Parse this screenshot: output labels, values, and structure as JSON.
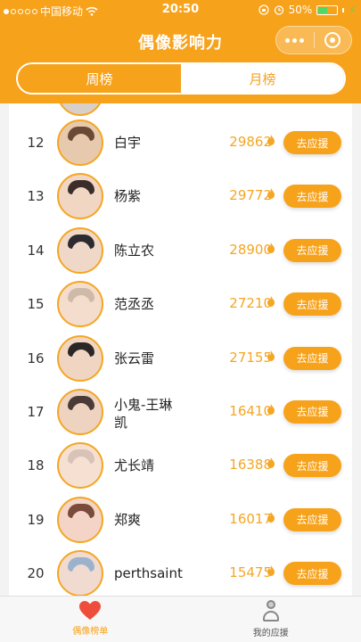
{
  "status_bar": {
    "carrier": "中国移动",
    "time": "20:50",
    "battery_pct": "50%",
    "battery_level": 0.5,
    "signal_dots_filled": 1,
    "icons": [
      "wifi-icon",
      "lock-rotation-icon",
      "alarm-icon",
      "battery-icon",
      "charging-icon"
    ]
  },
  "nav": {
    "title": "偶像影响力",
    "more_icon": "more-dots-icon",
    "close_icon": "target-circle-icon"
  },
  "tabs": [
    {
      "label": "周榜",
      "active": false
    },
    {
      "label": "月榜",
      "active": true
    }
  ],
  "list": {
    "support_label": "去应援",
    "score_icon": "flame-icon",
    "items": [
      {
        "rank": "12",
        "name": "白宇",
        "score": "29862"
      },
      {
        "rank": "13",
        "name": "杨紫",
        "score": "29772"
      },
      {
        "rank": "14",
        "name": "陈立农",
        "score": "28900"
      },
      {
        "rank": "15",
        "name": "范丞丞",
        "score": "27210"
      },
      {
        "rank": "16",
        "name": "张云雷",
        "score": "27155"
      },
      {
        "rank": "17",
        "name": "小鬼-王琳凯",
        "score": "16410"
      },
      {
        "rank": "18",
        "name": "尤长靖",
        "score": "16388"
      },
      {
        "rank": "19",
        "name": "郑爽",
        "score": "16017"
      },
      {
        "rank": "20",
        "name": "perthsaint",
        "score": "15475"
      }
    ]
  },
  "bottom_nav": [
    {
      "label": "偶像榜单",
      "icon": "heart-icon",
      "active": true
    },
    {
      "label": "我的应援",
      "icon": "person-icon",
      "active": false
    }
  ],
  "colors": {
    "brand": "#f7a21b",
    "score": "#f5a623",
    "text": "#222222"
  }
}
